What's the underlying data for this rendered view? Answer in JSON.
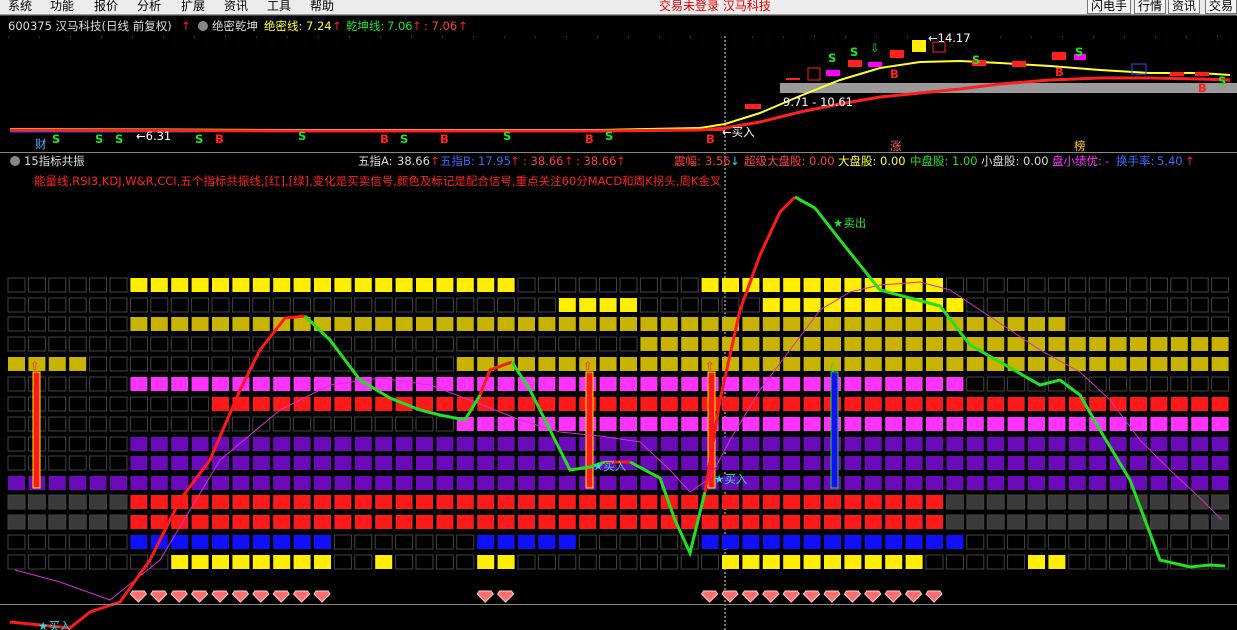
{
  "menubar": {
    "items": [
      "系统",
      "功能",
      "报价",
      "分析",
      "扩展",
      "资讯",
      "工具",
      "帮助"
    ],
    "center_text": "交易未登录  汉马科技",
    "right_buttons": [
      "闪电手",
      "行情",
      "资讯",
      "交易"
    ]
  },
  "upper_panel": {
    "stock_title": "600375 汉马科技(日线 前复权)",
    "indicator_name": "绝密乾坤",
    "jm_label": "绝密线:",
    "jm_value": "7.24",
    "qk_label": "乾坤线:",
    "qk_value": "7.06",
    "extra_value": ": 7.06",
    "price_high_label": "14.17",
    "price_mid_label": "9.71 - 10.61",
    "price_low_label": "6.31",
    "buy_label": "买入",
    "cai_label": "财",
    "zhang_label": "涨",
    "bang_label": "榜",
    "colors": {
      "jm_line": "#ffff33",
      "qk_line": "#ff2020",
      "gray_band": "#9a9a9a"
    }
  },
  "lower_panel": {
    "indicator_name": "15指标共振",
    "wz_a_label": "五指A:",
    "wz_a_value": "38.66",
    "wz_b_label": "五指B:",
    "wz_b_value": "17.95",
    "extra1": ": 38.66",
    "extra2": ": 38.66",
    "zf_label": "震幅:",
    "zf_value": "3.56",
    "cjdp_label": "超级大盘股:",
    "cjdp_value": "0.00",
    "dp_label": "大盘股:",
    "dp_value": "0.00",
    "zp_label": "中盘股:",
    "zp_value": "1.00",
    "xp_label": "小盘股:",
    "xp_value": "0.00",
    "pxjy_label": "盘小绩优:",
    "pxjy_value": "-",
    "hsl_label": "换手率:",
    "hsl_value": "5.40",
    "description": "能量线,RSI3,KDJ,W&R,CCI,五个指标共振线,[红],[绿],变化是买卖信号,颜色及标记是配合信号,重点关注60分MACD和周K拐头,周K金叉",
    "sell_label": "卖出",
    "buy_label": "买入",
    "colors": {
      "red": "#ff1a1a",
      "green": "#22e022",
      "magenta": "#ff33ff",
      "yellow": "#ffee00",
      "olive": "#c8b400",
      "purple": "#6a0ab8",
      "blue": "#1010ff",
      "gray": "#3a3a3a"
    }
  }
}
